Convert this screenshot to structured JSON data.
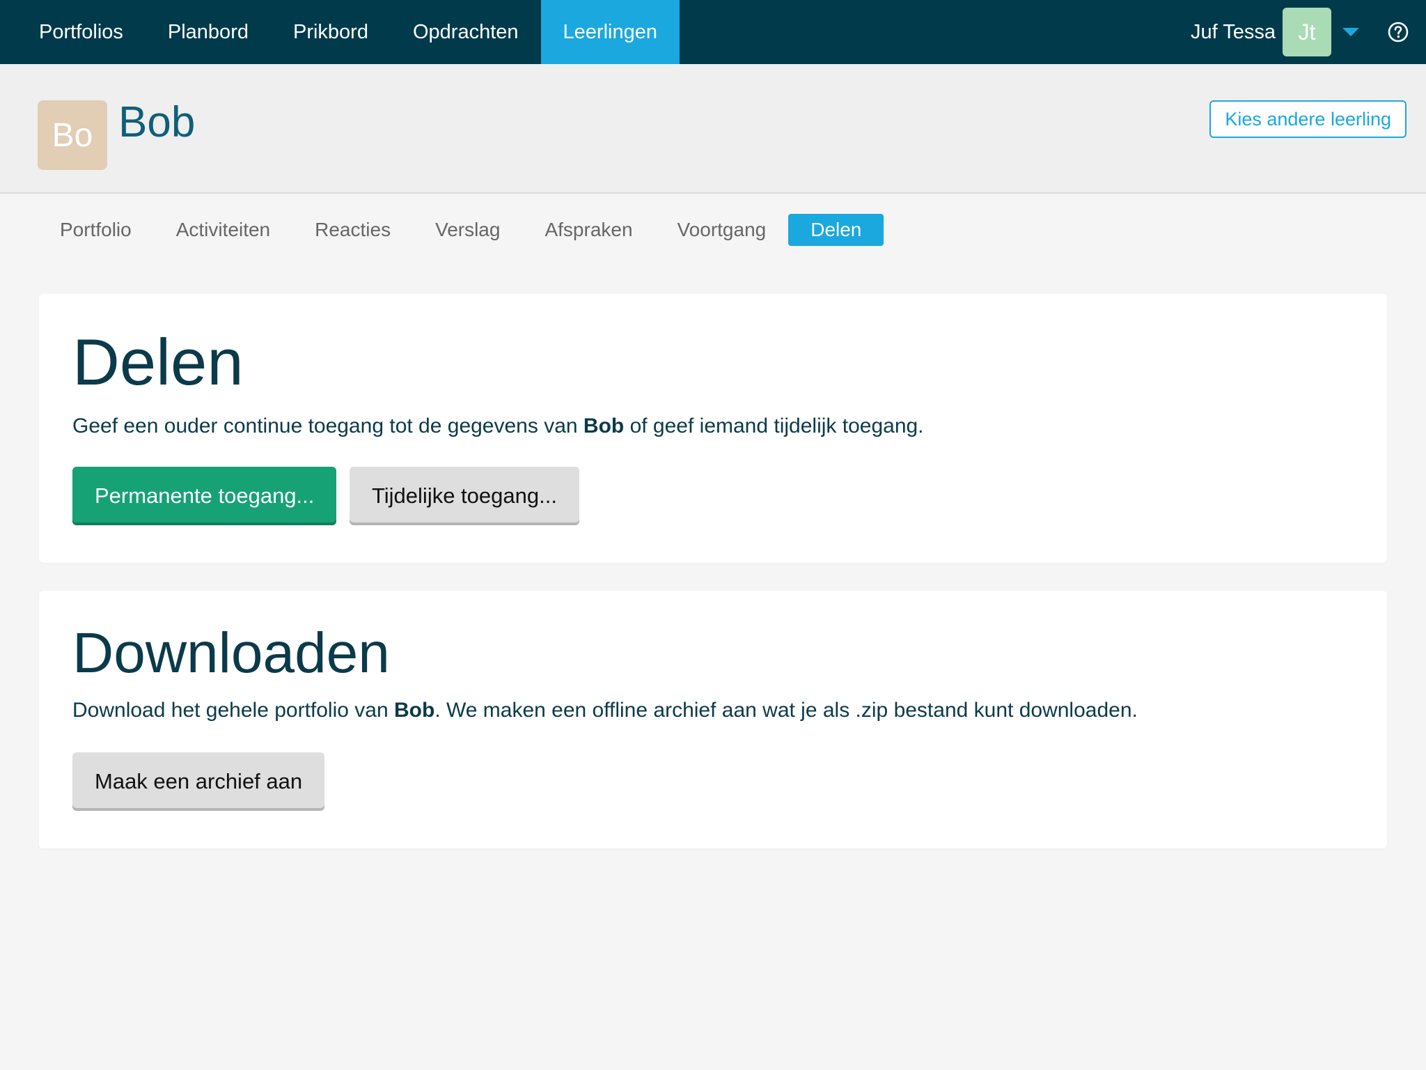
{
  "topnav": {
    "items": [
      {
        "label": "Portfolios",
        "active": false
      },
      {
        "label": "Planbord",
        "active": false
      },
      {
        "label": "Prikbord",
        "active": false
      },
      {
        "label": "Opdrachten",
        "active": false
      },
      {
        "label": "Leerlingen",
        "active": true
      }
    ],
    "user": {
      "name": "Juf Tessa",
      "initials": "Jt"
    },
    "icons": {
      "dropdown": "caret-down-icon",
      "help": "help-circle-icon"
    }
  },
  "student": {
    "initials": "Bo",
    "name": "Bob",
    "switch_label": "Kies andere leerling"
  },
  "subtabs": [
    {
      "label": "Portfolio",
      "active": false
    },
    {
      "label": "Activiteiten",
      "active": false
    },
    {
      "label": "Reacties",
      "active": false
    },
    {
      "label": "Verslag",
      "active": false
    },
    {
      "label": "Afspraken",
      "active": false
    },
    {
      "label": "Voortgang",
      "active": false
    },
    {
      "label": "Delen",
      "active": true
    }
  ],
  "share": {
    "title": "Delen",
    "text_before": "Geef een ouder continue toegang tot de gegevens van ",
    "text_bold": "Bob",
    "text_after": " of geef iemand tijdelijk toegang.",
    "permanent_button": "Permanente toegang...",
    "temporary_button": "Tijdelijke toegang..."
  },
  "download": {
    "title": "Downloaden",
    "text_before": "Download het gehele portfolio van ",
    "text_bold": "Bob",
    "text_after": ". We maken een offline archief aan wat je als .zip bestand kunt downloaden.",
    "archive_button": "Maak een archief aan"
  },
  "colors": {
    "topbar": "#003a4b",
    "accent": "#1aa8de",
    "green": "#16a274",
    "heading": "#0b3a4a",
    "student_name": "#0f5f78",
    "student_avatar": "#e2cdb5",
    "user_avatar": "#a9dcb5"
  }
}
